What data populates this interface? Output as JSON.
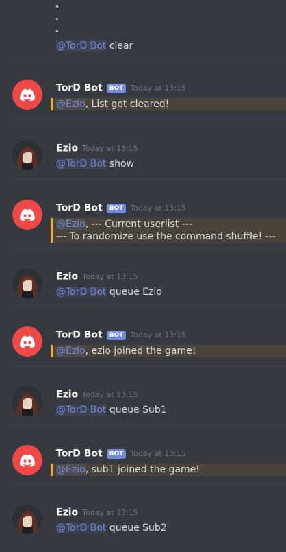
{
  "channel": {
    "continued": {
      "mention": "@TorD Bot",
      "text": " clear"
    }
  },
  "messages": [
    {
      "author": "TorD Bot",
      "bot": true,
      "badge": "BOT",
      "time": "Today at 13:15",
      "highlight": true,
      "lines": [
        {
          "mention": "@Ezio",
          "text": ", List got cleared!"
        }
      ]
    },
    {
      "author": "Ezio",
      "bot": false,
      "time": "Today at 13:15",
      "highlight": false,
      "lines": [
        {
          "mention": "@TorD Bot",
          "text": " show"
        }
      ]
    },
    {
      "author": "TorD Bot",
      "bot": true,
      "badge": "BOT",
      "time": "Today at 13:15",
      "highlight": true,
      "lines": [
        {
          "mention": "@Ezio",
          "text": ", --- Current userlist ---"
        },
        {
          "mention": "",
          "text": "--- To randomize use the command shuffle! ---"
        }
      ]
    },
    {
      "author": "Ezio",
      "bot": false,
      "time": "Today at 13:15",
      "highlight": false,
      "lines": [
        {
          "mention": "@TorD Bot",
          "text": " queue Ezio"
        }
      ]
    },
    {
      "author": "TorD Bot",
      "bot": true,
      "badge": "BOT",
      "time": "Today at 13:15",
      "highlight": true,
      "lines": [
        {
          "mention": "@Ezio",
          "text": ", ezio joined the game!"
        }
      ]
    },
    {
      "author": "Ezio",
      "bot": false,
      "time": "Today at 13:15",
      "highlight": false,
      "lines": [
        {
          "mention": "@TorD Bot",
          "text": " queue Sub1"
        }
      ]
    },
    {
      "author": "TorD Bot",
      "bot": true,
      "badge": "BOT",
      "time": "Today at 13:15",
      "highlight": true,
      "lines": [
        {
          "mention": "@Ezio",
          "text": ", sub1 joined the game!"
        }
      ]
    },
    {
      "author": "Ezio",
      "bot": false,
      "time": "Today at 13:15",
      "highlight": false,
      "lines": [
        {
          "mention": "@TorD Bot",
          "text": " queue Sub2"
        }
      ]
    }
  ],
  "colors": {
    "background": "#36393f",
    "mention": "#7289da",
    "bot_avatar": "#f04747",
    "highlight_bar": "#faa61a"
  },
  "icons": {
    "bot_avatar": "discord-logo-icon",
    "user_avatar": "user-avatar-icon"
  }
}
